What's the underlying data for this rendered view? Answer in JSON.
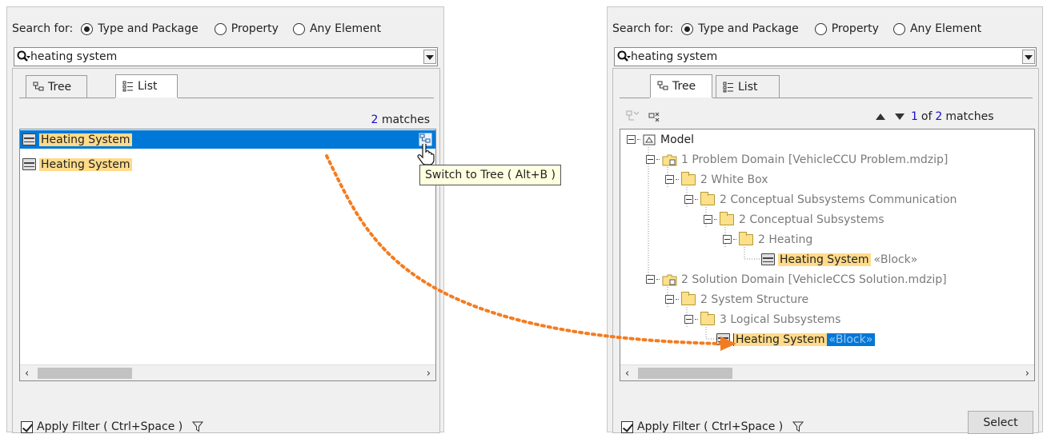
{
  "search_for_label": "Search for:",
  "radio_options": [
    "Type and Package",
    "Property",
    "Any Element"
  ],
  "search_value": "heating system",
  "tabs": {
    "tree": "Tree",
    "list": "List"
  },
  "left": {
    "count": "2",
    "matches_label": "matches",
    "results": [
      "Heating System",
      "Heating System"
    ],
    "tooltip": "Switch to Tree ( Alt+B )"
  },
  "right": {
    "nav_current": "1",
    "nav_of": "of",
    "nav_total": "2",
    "nav_matches": "matches",
    "tree": {
      "root": "Model",
      "n1": "1 Problem Domain [VehicleCCU Problem.mdzip]",
      "n2": "2 White Box",
      "n3": "2 Conceptual Subsystems Communication",
      "n4": "2 Conceptual Subsystems",
      "n5": "2 Heating",
      "n6_name": "Heating System",
      "n6_stereo": "«Block»",
      "n7": "2 Solution Domain [VehicleCCS Solution.mdzip]",
      "n8": "2 System Structure",
      "n9": "3 Logical Subsystems",
      "n10_name": "Heating System",
      "n10_stereo": "«Block»"
    },
    "select_label": "Select"
  },
  "apply_filter_label": "Apply Filter ( Ctrl+Space )",
  "colors": {
    "selection": "#0078d7",
    "highlight": "#ffdb8a",
    "arrow": "#f47c20",
    "link": "#1a0dcd"
  }
}
